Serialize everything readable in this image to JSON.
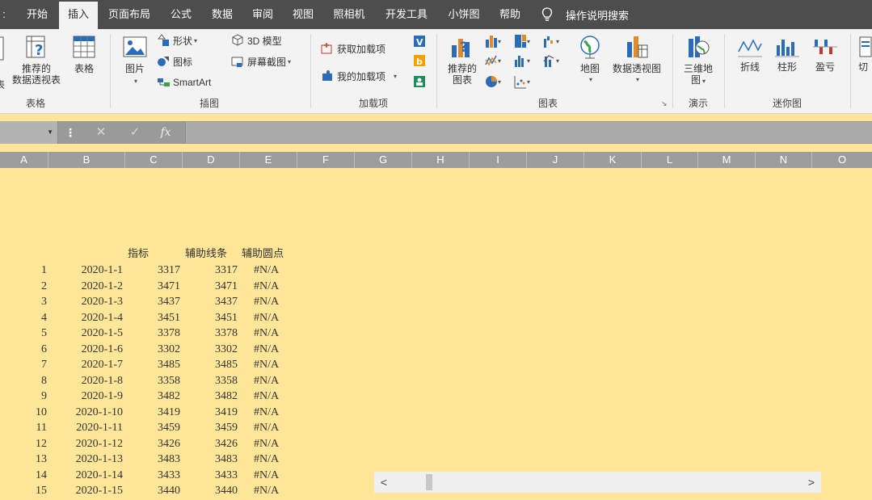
{
  "menu": {
    "items": [
      "开始",
      "插入",
      "页面布局",
      "公式",
      "数据",
      "审阅",
      "视图",
      "照相机",
      "开发工具",
      "小饼图",
      "帮助"
    ],
    "active": "插入",
    "tell_me": "操作说明搜索"
  },
  "ribbon": {
    "tables": {
      "recommended_pivot": [
        "推荐的",
        "数据透视表"
      ],
      "table": "表格",
      "group": "表格",
      "cut_label": "表"
    },
    "illustrations": {
      "picture": "图片",
      "shapes": "形状",
      "icons": "图标",
      "smartart": "SmartArt",
      "model3d": "3D 模型",
      "screenshot": "屏幕截图",
      "group": "插图"
    },
    "addins": {
      "get": "获取加载项",
      "my": "我的加载项",
      "group": "加载项"
    },
    "charts": {
      "recommended": [
        "推荐的",
        "图表"
      ],
      "maps": "地图",
      "pivot_chart": "数据透视图",
      "group": "图表"
    },
    "tours": {
      "map3d": [
        "三维地",
        "图"
      ],
      "group": "演示"
    },
    "sparklines": {
      "line": "折线",
      "column": "柱形",
      "winloss": "盈亏",
      "group": "迷你图"
    },
    "slicer": "切"
  },
  "formula_bar": {
    "fx": "fx",
    "value": ""
  },
  "columns": [
    "A",
    "B",
    "C",
    "D",
    "E",
    "F",
    "G",
    "H",
    "I",
    "J",
    "K",
    "L",
    "M",
    "N",
    "O"
  ],
  "sheet": {
    "headers": [
      "指标",
      "辅助线条",
      "辅助圆点"
    ],
    "rows": [
      [
        "1",
        "2020-1-1",
        "3317",
        "3317",
        "#N/A"
      ],
      [
        "2",
        "2020-1-2",
        "3471",
        "3471",
        "#N/A"
      ],
      [
        "3",
        "2020-1-3",
        "3437",
        "3437",
        "#N/A"
      ],
      [
        "4",
        "2020-1-4",
        "3451",
        "3451",
        "#N/A"
      ],
      [
        "5",
        "2020-1-5",
        "3378",
        "3378",
        "#N/A"
      ],
      [
        "6",
        "2020-1-6",
        "3302",
        "3302",
        "#N/A"
      ],
      [
        "7",
        "2020-1-7",
        "3485",
        "3485",
        "#N/A"
      ],
      [
        "8",
        "2020-1-8",
        "3358",
        "3358",
        "#N/A"
      ],
      [
        "9",
        "2020-1-9",
        "3482",
        "3482",
        "#N/A"
      ],
      [
        "10",
        "2020-1-10",
        "3419",
        "3419",
        "#N/A"
      ],
      [
        "11",
        "2020-1-11",
        "3459",
        "3459",
        "#N/A"
      ],
      [
        "12",
        "2020-1-12",
        "3426",
        "3426",
        "#N/A"
      ],
      [
        "13",
        "2020-1-13",
        "3483",
        "3483",
        "#N/A"
      ],
      [
        "14",
        "2020-1-14",
        "3433",
        "3433",
        "#N/A"
      ],
      [
        "15",
        "2020-1-15",
        "3440",
        "3440",
        "#N/A"
      ]
    ]
  },
  "colors": {
    "menubar": "#4d4d4d",
    "ribbon": "#f3f3f3",
    "sheet_fill": "#FFE699"
  }
}
